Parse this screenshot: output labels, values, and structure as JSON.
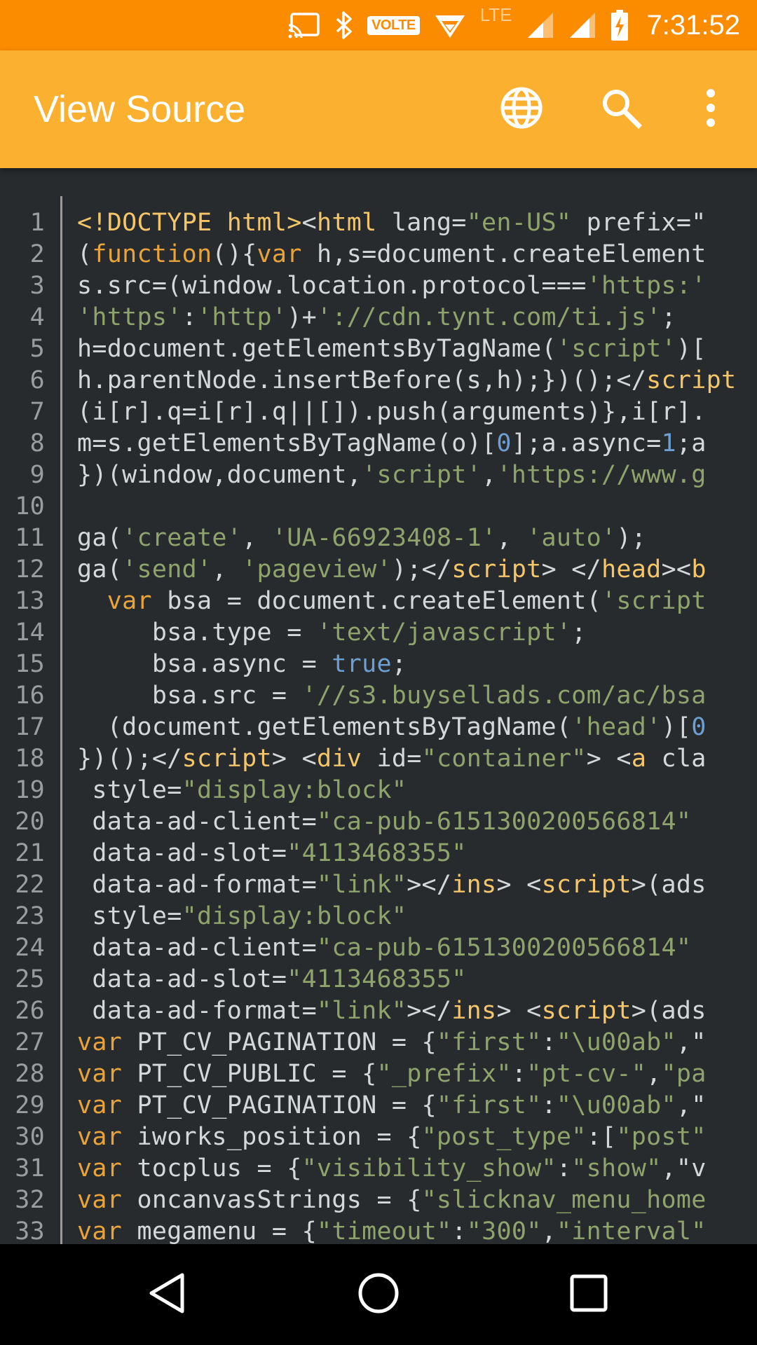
{
  "status_bar": {
    "time": "7:31:52",
    "volte_label": "VOLTE",
    "lte_label": "LTE",
    "icons": [
      "cast-icon",
      "bluetooth-icon",
      "volte-icon",
      "wifi-icon",
      "signal-icon",
      "signal-icon",
      "battery-charging-icon"
    ]
  },
  "app_bar": {
    "title": "View Source",
    "actions": [
      "globe-icon",
      "search-icon",
      "more-vert-icon"
    ]
  },
  "code": {
    "lines": [
      {
        "n": "1",
        "t": [
          [
            "tag",
            "<!DOCTYPE html>"
          ],
          [
            "plain",
            "<"
          ],
          [
            "tag",
            "html"
          ],
          [
            "plain",
            " lang="
          ],
          [
            "str",
            "\"en-US\""
          ],
          [
            "plain",
            " prefix=\""
          ]
        ]
      },
      {
        "n": "2",
        "t": [
          [
            "plain",
            "("
          ],
          [
            "kw",
            "function"
          ],
          [
            "plain",
            "(){"
          ],
          [
            "kw",
            "var"
          ],
          [
            "plain",
            " h,s=document.createElement"
          ]
        ]
      },
      {
        "n": "3",
        "t": [
          [
            "plain",
            "s.src=(window.location.protocol==="
          ],
          [
            "str",
            "'https:'"
          ]
        ]
      },
      {
        "n": "4",
        "t": [
          [
            "str",
            "'https'"
          ],
          [
            "plain",
            ":"
          ],
          [
            "str",
            "'http'"
          ],
          [
            "plain",
            ")+"
          ],
          [
            "str",
            "'://cdn.tynt.com/ti.js'"
          ],
          [
            "plain",
            ";"
          ]
        ]
      },
      {
        "n": "5",
        "t": [
          [
            "plain",
            "h=document.getElementsByTagName("
          ],
          [
            "str",
            "'script'"
          ],
          [
            "plain",
            ")["
          ]
        ]
      },
      {
        "n": "6",
        "t": [
          [
            "plain",
            "h.parentNode.insertBefore(s,h);})();</"
          ],
          [
            "tag",
            "script"
          ]
        ]
      },
      {
        "n": "7",
        "t": [
          [
            "plain",
            "(i[r].q=i[r].q||[]).push(arguments)},i[r]."
          ]
        ]
      },
      {
        "n": "8",
        "t": [
          [
            "plain",
            "m=s.getElementsByTagName(o)["
          ],
          [
            "num",
            "0"
          ],
          [
            "plain",
            "];a.async="
          ],
          [
            "num",
            "1"
          ],
          [
            "plain",
            ";a"
          ]
        ]
      },
      {
        "n": "9",
        "t": [
          [
            "plain",
            "})(window,document,"
          ],
          [
            "str",
            "'script'"
          ],
          [
            "plain",
            ","
          ],
          [
            "str",
            "'https://www.g"
          ]
        ]
      },
      {
        "n": "10",
        "t": []
      },
      {
        "n": "11",
        "t": [
          [
            "plain",
            "ga("
          ],
          [
            "str",
            "'create'"
          ],
          [
            "plain",
            ", "
          ],
          [
            "str",
            "'UA-66923408-1'"
          ],
          [
            "plain",
            ", "
          ],
          [
            "str",
            "'auto'"
          ],
          [
            "plain",
            ");"
          ]
        ]
      },
      {
        "n": "12",
        "t": [
          [
            "plain",
            "ga("
          ],
          [
            "str",
            "'send'"
          ],
          [
            "plain",
            ", "
          ],
          [
            "str",
            "'pageview'"
          ],
          [
            "plain",
            ");</"
          ],
          [
            "tag",
            "script"
          ],
          [
            "plain",
            "> </"
          ],
          [
            "tag",
            "head"
          ],
          [
            "plain",
            "><"
          ],
          [
            "tag",
            "b"
          ]
        ]
      },
      {
        "n": "13",
        "t": [
          [
            "plain",
            "  "
          ],
          [
            "kw",
            "var"
          ],
          [
            "plain",
            " bsa = document.createElement("
          ],
          [
            "str",
            "'script"
          ]
        ]
      },
      {
        "n": "14",
        "t": [
          [
            "plain",
            "     bsa.type = "
          ],
          [
            "str",
            "'text/javascript'"
          ],
          [
            "plain",
            ";"
          ]
        ]
      },
      {
        "n": "15",
        "t": [
          [
            "plain",
            "     bsa.async = "
          ],
          [
            "num",
            "true"
          ],
          [
            "plain",
            ";"
          ]
        ]
      },
      {
        "n": "16",
        "t": [
          [
            "plain",
            "     bsa.src = "
          ],
          [
            "str",
            "'//s3.buysellads.com/ac/bsa"
          ]
        ]
      },
      {
        "n": "17",
        "t": [
          [
            "plain",
            "  (document.getElementsByTagName("
          ],
          [
            "str",
            "'head'"
          ],
          [
            "plain",
            ")["
          ],
          [
            "num",
            "0"
          ]
        ]
      },
      {
        "n": "18",
        "t": [
          [
            "plain",
            "})();</"
          ],
          [
            "tag",
            "script"
          ],
          [
            "plain",
            "> <"
          ],
          [
            "tag",
            "div"
          ],
          [
            "plain",
            " id="
          ],
          [
            "str",
            "\"container\""
          ],
          [
            "plain",
            "> <"
          ],
          [
            "tag",
            "a"
          ],
          [
            "plain",
            " cla"
          ]
        ]
      },
      {
        "n": "19",
        "t": [
          [
            "plain",
            " style="
          ],
          [
            "str",
            "\"display:block\""
          ]
        ]
      },
      {
        "n": "20",
        "t": [
          [
            "plain",
            " data-ad-client="
          ],
          [
            "str",
            "\"ca-pub-6151300200566814\""
          ]
        ]
      },
      {
        "n": "21",
        "t": [
          [
            "plain",
            " data-ad-slot="
          ],
          [
            "str",
            "\"4113468355\""
          ]
        ]
      },
      {
        "n": "22",
        "t": [
          [
            "plain",
            " data-ad-format="
          ],
          [
            "str",
            "\"link\""
          ],
          [
            "plain",
            "></"
          ],
          [
            "tag",
            "ins"
          ],
          [
            "plain",
            "> <"
          ],
          [
            "tag",
            "script"
          ],
          [
            "plain",
            ">(ads"
          ]
        ]
      },
      {
        "n": "23",
        "t": [
          [
            "plain",
            " style="
          ],
          [
            "str",
            "\"display:block\""
          ]
        ]
      },
      {
        "n": "24",
        "t": [
          [
            "plain",
            " data-ad-client="
          ],
          [
            "str",
            "\"ca-pub-6151300200566814\""
          ]
        ]
      },
      {
        "n": "25",
        "t": [
          [
            "plain",
            " data-ad-slot="
          ],
          [
            "str",
            "\"4113468355\""
          ]
        ]
      },
      {
        "n": "26",
        "t": [
          [
            "plain",
            " data-ad-format="
          ],
          [
            "str",
            "\"link\""
          ],
          [
            "plain",
            "></"
          ],
          [
            "tag",
            "ins"
          ],
          [
            "plain",
            "> <"
          ],
          [
            "tag",
            "script"
          ],
          [
            "plain",
            ">(ads"
          ]
        ]
      },
      {
        "n": "27",
        "t": [
          [
            "kw",
            "var"
          ],
          [
            "plain",
            " PT_CV_PAGINATION = {"
          ],
          [
            "str",
            "\"first\""
          ],
          [
            "plain",
            ":"
          ],
          [
            "str",
            "\"\\u00ab\""
          ],
          [
            "plain",
            ",\""
          ]
        ]
      },
      {
        "n": "28",
        "t": [
          [
            "kw",
            "var"
          ],
          [
            "plain",
            " PT_CV_PUBLIC = {"
          ],
          [
            "str",
            "\"_prefix\""
          ],
          [
            "plain",
            ":"
          ],
          [
            "str",
            "\"pt-cv-\""
          ],
          [
            "plain",
            ","
          ],
          [
            "str",
            "\"pa"
          ]
        ]
      },
      {
        "n": "29",
        "t": [
          [
            "kw",
            "var"
          ],
          [
            "plain",
            " PT_CV_PAGINATION = {"
          ],
          [
            "str",
            "\"first\""
          ],
          [
            "plain",
            ":"
          ],
          [
            "str",
            "\"\\u00ab\""
          ],
          [
            "plain",
            ",\""
          ]
        ]
      },
      {
        "n": "30",
        "t": [
          [
            "kw",
            "var"
          ],
          [
            "plain",
            " iworks_position = {"
          ],
          [
            "str",
            "\"post_type\""
          ],
          [
            "plain",
            ":["
          ],
          [
            "str",
            "\"post\""
          ]
        ]
      },
      {
        "n": "31",
        "t": [
          [
            "kw",
            "var"
          ],
          [
            "plain",
            " tocplus = {"
          ],
          [
            "str",
            "\"visibility_show\""
          ],
          [
            "plain",
            ":"
          ],
          [
            "str",
            "\"show\""
          ],
          [
            "plain",
            ",\"v"
          ]
        ]
      },
      {
        "n": "32",
        "t": [
          [
            "kw",
            "var"
          ],
          [
            "plain",
            " oncanvasStrings = {"
          ],
          [
            "str",
            "\"slicknav_menu_home"
          ]
        ]
      },
      {
        "n": "33",
        "t": [
          [
            "kw",
            "var"
          ],
          [
            "plain",
            " megamenu = {"
          ],
          [
            "str",
            "\"timeout\""
          ],
          [
            "plain",
            ":"
          ],
          [
            "str",
            "\"300\""
          ],
          [
            "plain",
            ","
          ],
          [
            "str",
            "\"interval\""
          ]
        ]
      }
    ]
  },
  "nav_bar": {
    "buttons": [
      "back-icon",
      "home-icon",
      "recents-icon"
    ]
  },
  "colors": {
    "status_bar": "#fb8c00",
    "app_bar": "#fbb030",
    "editor_bg": "#282b2e",
    "keyword": "#e8a33b",
    "string": "#8fa36d",
    "tag": "#f5c56a",
    "number": "#6d9fd0",
    "plain": "#d5d8da"
  }
}
